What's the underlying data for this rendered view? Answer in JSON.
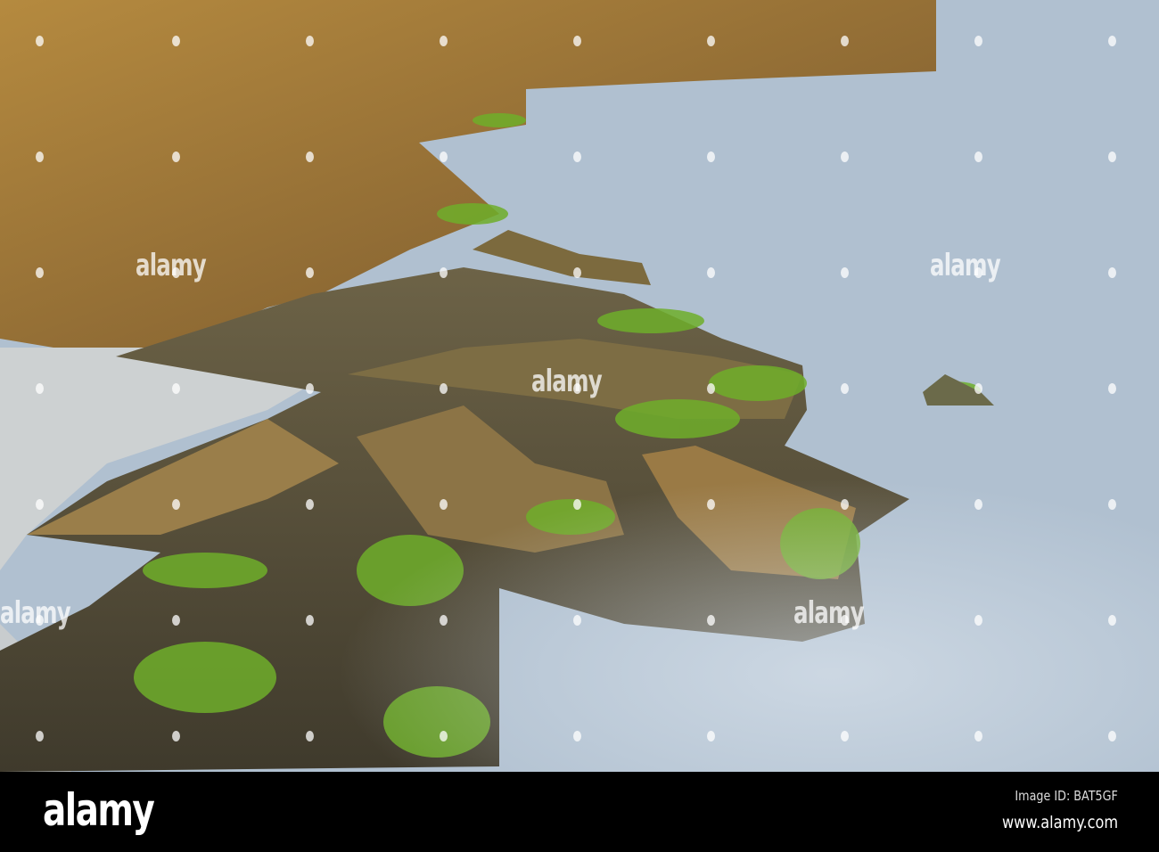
{
  "photo": {
    "watermark": "alamy",
    "colors": {
      "rock": "#a27a3c",
      "rock_dark": "#4e4632",
      "moss": "#6fae2a",
      "sand": "#c9cfd3",
      "water": "#b3c3d3"
    }
  },
  "footer": {
    "logo": "alamy",
    "image_id": "Image ID: BAT5GF",
    "website": "www.alamy.com"
  }
}
